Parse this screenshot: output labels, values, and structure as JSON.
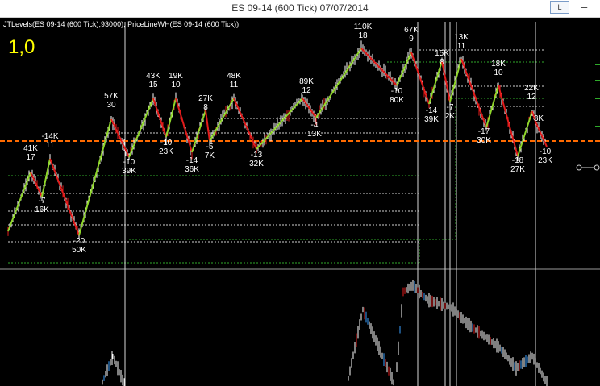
{
  "window": {
    "title": "ES 09-14 (600 Tick)  07/07/2014",
    "box_label": "L",
    "min_glyph": "–"
  },
  "indicator_label": "JTLevels(ES 09-14 (600 Tick),93000), PriceLineWH(ES 09-14 (600 Tick))",
  "corner_label": "1,0",
  "colors": {
    "background": "#000000",
    "up_swing": "#8fd62b",
    "down_swing": "#e31b1b",
    "price_line": "#ff6a00",
    "level_lines": "#cfcfcf",
    "green_lines": "#2faa2a",
    "bars": "#ffffff",
    "label": "#ffffff",
    "corner_label": "#ffff00"
  },
  "chart_data": {
    "type": "line",
    "swing_points": [
      {
        "label": [
          "41K",
          "17"
        ]
      },
      {
        "label": [
          "-7",
          "16K"
        ]
      },
      {
        "label": [
          "-14K",
          "11"
        ]
      },
      {
        "label": [
          "-20",
          "50K"
        ]
      },
      {
        "label": [
          "57K",
          "30"
        ]
      },
      {
        "label": [
          "-10",
          "39K"
        ]
      },
      {
        "label": [
          "43K",
          "15"
        ]
      },
      {
        "label": [
          "-10",
          "23K"
        ]
      },
      {
        "label": [
          "19K",
          "10"
        ]
      },
      {
        "label": [
          "-14",
          "36K"
        ]
      },
      {
        "label": [
          "27K",
          "8"
        ]
      },
      {
        "label": [
          "-5",
          "7K"
        ]
      },
      {
        "label": [
          "48K",
          "11"
        ]
      },
      {
        "label": [
          "-13",
          "32K"
        ]
      },
      {
        "label": [
          "89K",
          "12"
        ]
      },
      {
        "label": [
          "-4",
          "13K"
        ]
      },
      {
        "label": [
          "110K",
          "18"
        ]
      },
      {
        "label": [
          "-10",
          "80K"
        ]
      },
      {
        "label": [
          "67K",
          "9"
        ]
      },
      {
        "label": [
          "-14",
          "39K"
        ]
      },
      {
        "label": [
          "15K",
          "8"
        ]
      },
      {
        "label": [
          "-7",
          "2K"
        ]
      },
      {
        "label": [
          "13K",
          "11"
        ]
      },
      {
        "label": [
          "-17",
          "30K"
        ]
      },
      {
        "label": [
          "18K",
          "10"
        ]
      },
      {
        "label": [
          "-18",
          "27K"
        ]
      },
      {
        "label": [
          "22K",
          "12"
        ]
      },
      {
        "label": [
          "3K",
          ""
        ]
      },
      {
        "label": [
          "-10",
          "23K"
        ]
      }
    ]
  }
}
